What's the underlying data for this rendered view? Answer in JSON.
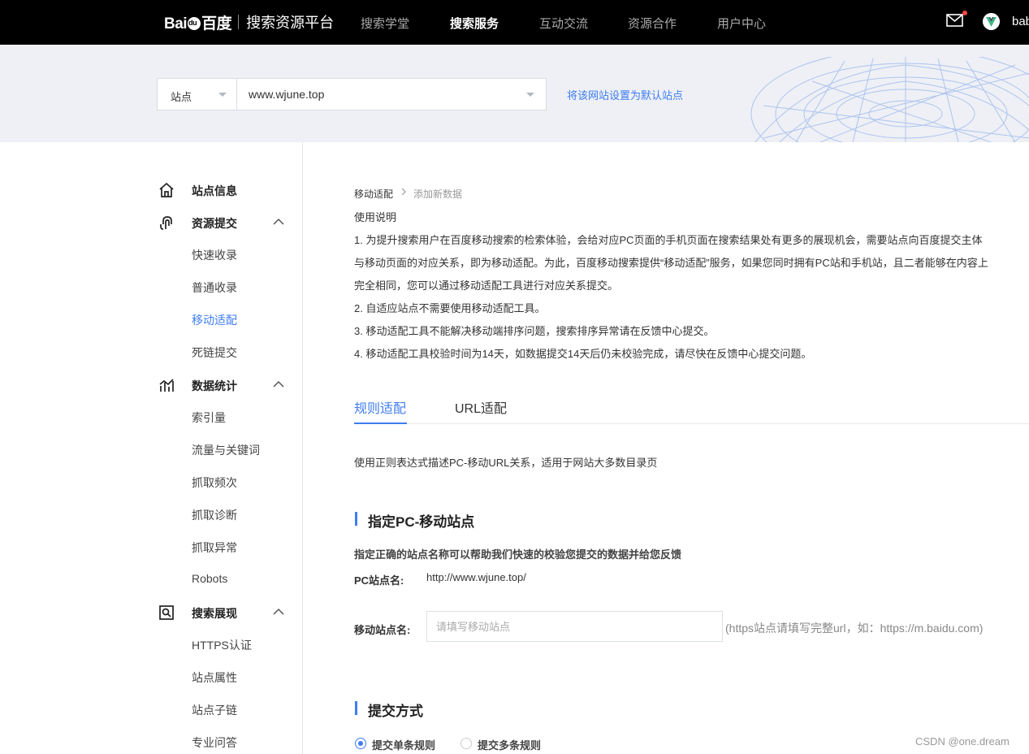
{
  "header": {
    "logo_text": "Bai",
    "logo_text2": "百度",
    "platform_name": "搜索资源平台",
    "nav": [
      {
        "label": "搜索学堂",
        "active": false
      },
      {
        "label": "搜索服务",
        "active": true
      },
      {
        "label": "互动交流",
        "active": false
      },
      {
        "label": "资源合作",
        "active": false
      },
      {
        "label": "用户中心",
        "active": false
      }
    ],
    "user_name": "bab"
  },
  "site_bar": {
    "select_label": "站点",
    "site_value": "www.wjune.top",
    "default_link": "将该网站设置为默认站点"
  },
  "sidebar": {
    "site_info": "站点信息",
    "resource_submit": "资源提交",
    "resource_items": [
      "快速收录",
      "普通收录",
      "移动适配",
      "死链提交"
    ],
    "data_stats": "数据统计",
    "data_items": [
      "索引量",
      "流量与关键词",
      "抓取频次",
      "抓取诊断",
      "抓取异常",
      "Robots"
    ],
    "search_display": "搜索展现",
    "display_items": [
      "HTTPS认证",
      "站点属性",
      "站点子链",
      "专业问答"
    ]
  },
  "main": {
    "breadcrumb": [
      "移动适配",
      "添加新数据"
    ],
    "usage_title": "使用说明",
    "paragraphs": [
      "1. 为提升搜索用户在百度移动搜索的检索体验，会给对应PC页面的手机页面在搜索结果处有更多的展现机会，需要站点向百度提交主体",
      "与移动页面的对应关系，即为移动适配。为此，百度移动搜索提供“移动适配”服务，如果您同时拥有PC站和手机站，且二者能够在内容上",
      "完全相同，您可以通过移动适配工具进行对应关系提交。",
      "2. 自适应站点不需要使用移动适配工具。",
      "3. 移动适配工具不能解决移动端排序问题，搜索排序异常请在反馈中心提交。",
      "4. 移动适配工具校验时间为14天，如数据提交14天后仍未校验完成，请尽快在反馈中心提交问题。"
    ],
    "tabs": [
      {
        "label": "规则适配",
        "active": true
      },
      {
        "label": "URL适配",
        "active": false
      }
    ],
    "rule_desc": "使用正则表达式描述PC-移动URL关系，适用于网站大多数目录页",
    "section1_title": "指定PC-移动站点",
    "section1_hint": "指定正确的站点名称可以帮助我们快速的校验您提交的数据并给您反馈",
    "pc_label": "PC站点名:",
    "pc_value": "http://www.wjune.top/",
    "mobile_label": "移动站点名:",
    "mobile_placeholder": "请填写移动站点",
    "mobile_tip": "(https站点请填写完整url，如：https://m.baidu.com)",
    "section2_title": "提交方式",
    "submit_options": [
      {
        "label": "提交单条规则",
        "checked": true
      },
      {
        "label": "提交多条规则",
        "checked": false
      }
    ]
  },
  "watermark": "CSDN @one.dream",
  "colors": {
    "accent": "#3f7df0",
    "topbar": "#000000",
    "banner": "#eef0f5"
  }
}
